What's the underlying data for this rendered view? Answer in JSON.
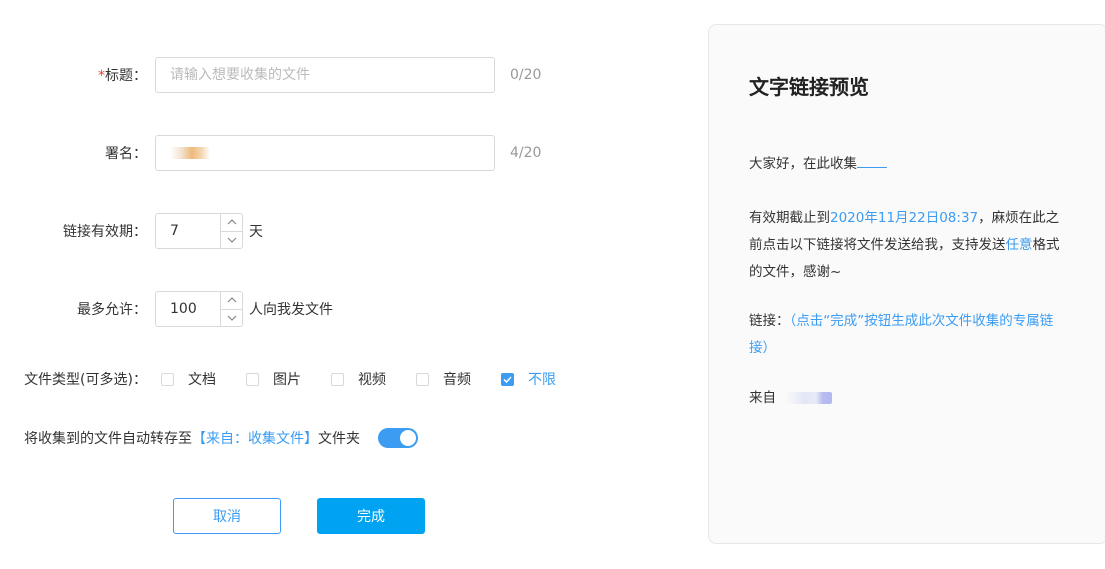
{
  "form": {
    "title_label": "*标题：",
    "title_placeholder": "请输入想要收集的文件",
    "title_count": "0/20",
    "signature_label": "署名：",
    "signature_count": "4/20",
    "validity_label": "链接有效期：",
    "validity_value": "7",
    "validity_unit": "天",
    "max_label": "最多允许：",
    "max_value": "100",
    "max_unit": "人向我发文件",
    "types_label": "文件类型(可多选)：",
    "types": [
      {
        "label": "文档",
        "checked": false
      },
      {
        "label": "图片",
        "checked": false
      },
      {
        "label": "视频",
        "checked": false
      },
      {
        "label": "音频",
        "checked": false
      },
      {
        "label": "不限",
        "checked": true
      }
    ],
    "auto_save_prefix": "将收集到的文件自动转存至",
    "auto_save_folder": "【来自：收集文件】",
    "auto_save_suffix": "文件夹",
    "auto_save_on": true,
    "cancel_label": "取消",
    "done_label": "完成"
  },
  "preview": {
    "title": "文字链接预览",
    "greeting": "大家好，在此收集",
    "deadline_prefix": "有效期截止到",
    "deadline_date": "2020年11月22日08:37",
    "deadline_mid": "，麻烦在此之前点击以下链接将文件发送给我，支持发送",
    "any_word": "任意",
    "deadline_suffix": "格式的文件，感谢~",
    "link_prefix": "链接：",
    "link_hint": "（点击“完成”按钮生成此次文件收集的专属链接）",
    "from_label": "来自"
  },
  "colors": {
    "accent": "#3b9cf2",
    "primary_button": "#00a2f2",
    "required": "#f04134"
  }
}
